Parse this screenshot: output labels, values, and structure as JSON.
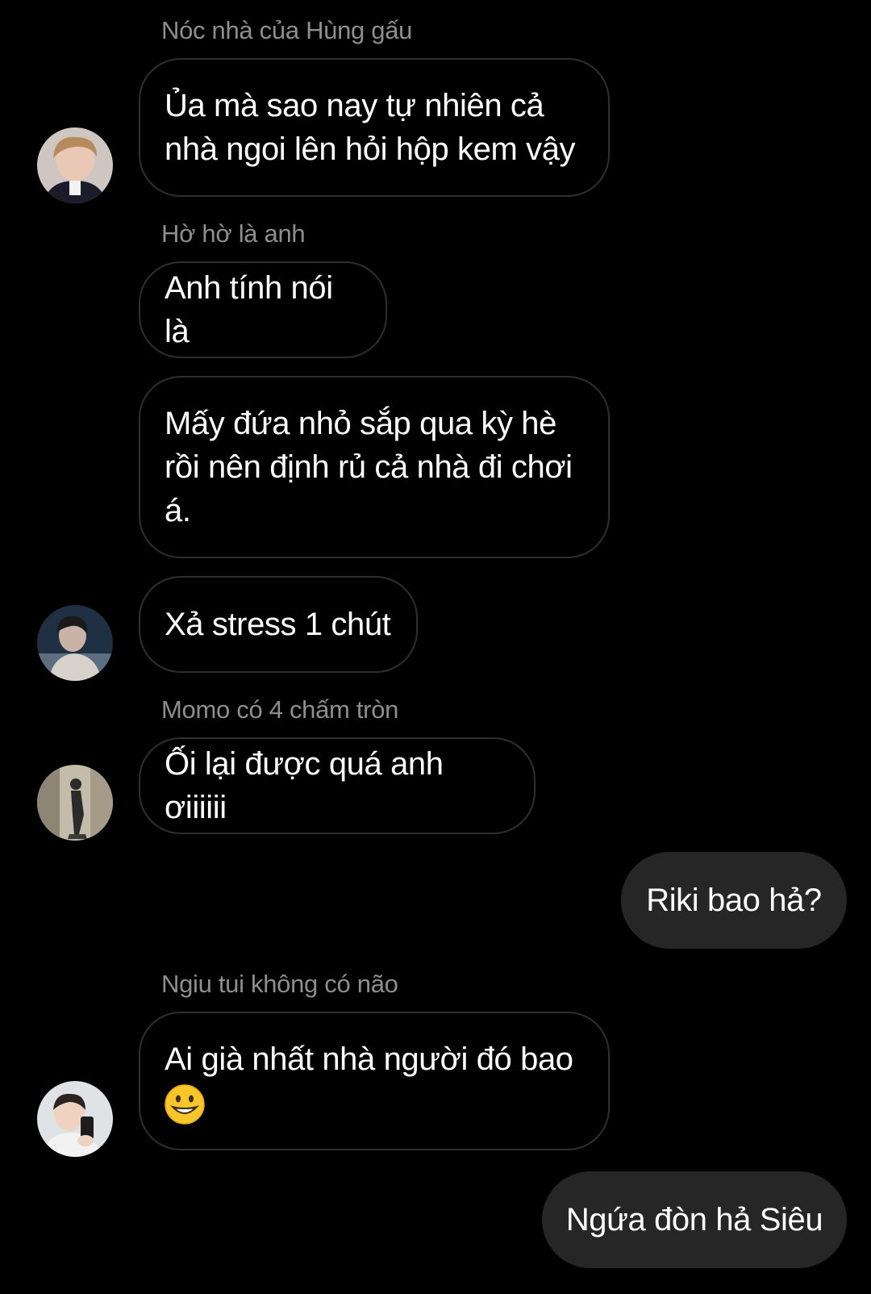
{
  "messages": [
    {
      "sender": "Nóc nhà của Hùng gấu",
      "lines": [
        "Ủa mà sao nay tự nhiên cả",
        "nhà ngoi lên hỏi hộp kem vậy"
      ]
    },
    {
      "sender": "Hờ hờ là anh",
      "lines": [
        "Anh tính nói là"
      ]
    },
    {
      "lines": [
        "Mấy đứa nhỏ sắp qua kỳ hè",
        "rồi nên định rủ cả nhà đi chơi",
        "á."
      ]
    },
    {
      "lines": [
        "Xả stress 1 chút"
      ]
    },
    {
      "sender": "Momo có 4 chấm tròn",
      "lines": [
        "Ối lại được quá anh ơiiiiii"
      ]
    },
    {
      "outgoing": true,
      "text": "Riki bao hả?"
    },
    {
      "sender": "Ngiu tui không có não",
      "lines": [
        "Ai già nhất nhà người đó bao"
      ],
      "emoji": "grinning-face-emoji"
    },
    {
      "outgoing": true,
      "text": "Ngứa đòn hả Siêu"
    }
  ],
  "colors": {
    "background": "#000000",
    "sender_name": "#8e8e8e",
    "incoming_border": "#2f2f2f",
    "outgoing_bubble": "#262626",
    "text": "#ffffff"
  }
}
